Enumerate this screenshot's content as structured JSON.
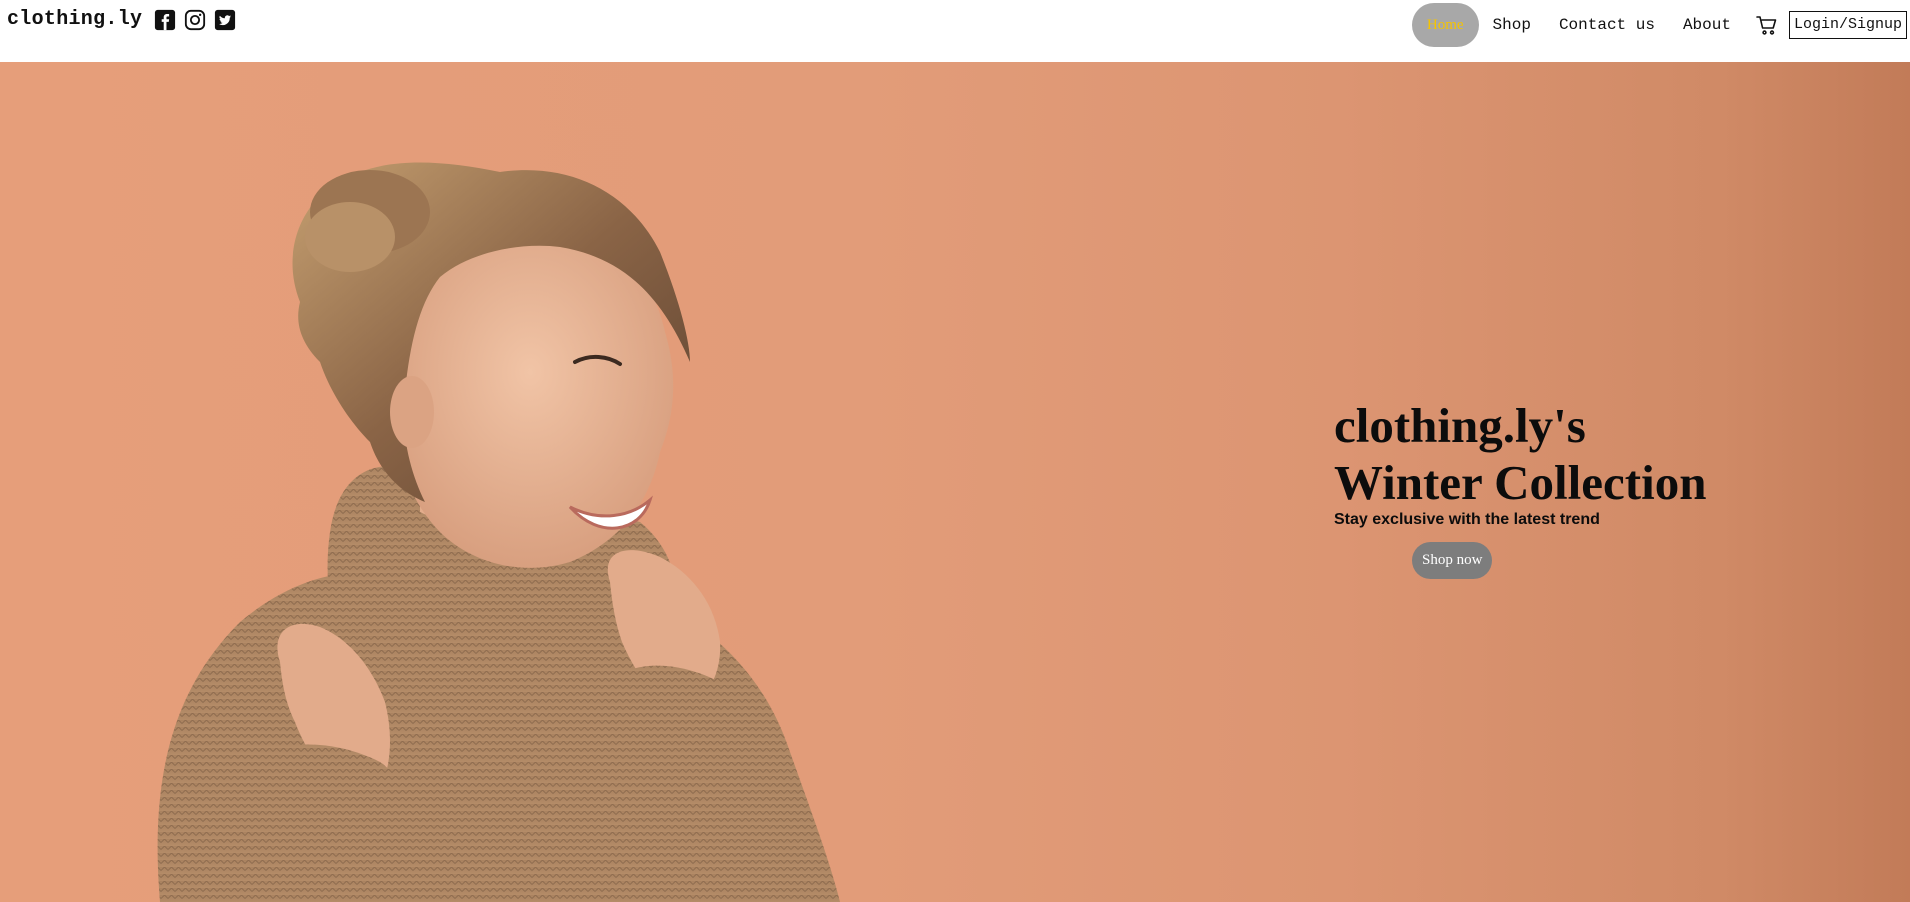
{
  "header": {
    "brand": "clothing.ly",
    "social_icons": [
      "facebook-icon",
      "instagram-icon",
      "twitter-icon"
    ],
    "nav": {
      "home": "Home",
      "shop": "Shop",
      "contact": "Contact us",
      "about": "About"
    },
    "cart_icon": "cart-icon",
    "login": "Login/Signup",
    "active_color": "#f6c400"
  },
  "hero": {
    "title_line1": "clothing.ly's",
    "title_line2": "Winter Collection",
    "subtitle": "Stay exclusive with the latest trend",
    "cta": "Shop now",
    "background_color": "#e29c79"
  }
}
